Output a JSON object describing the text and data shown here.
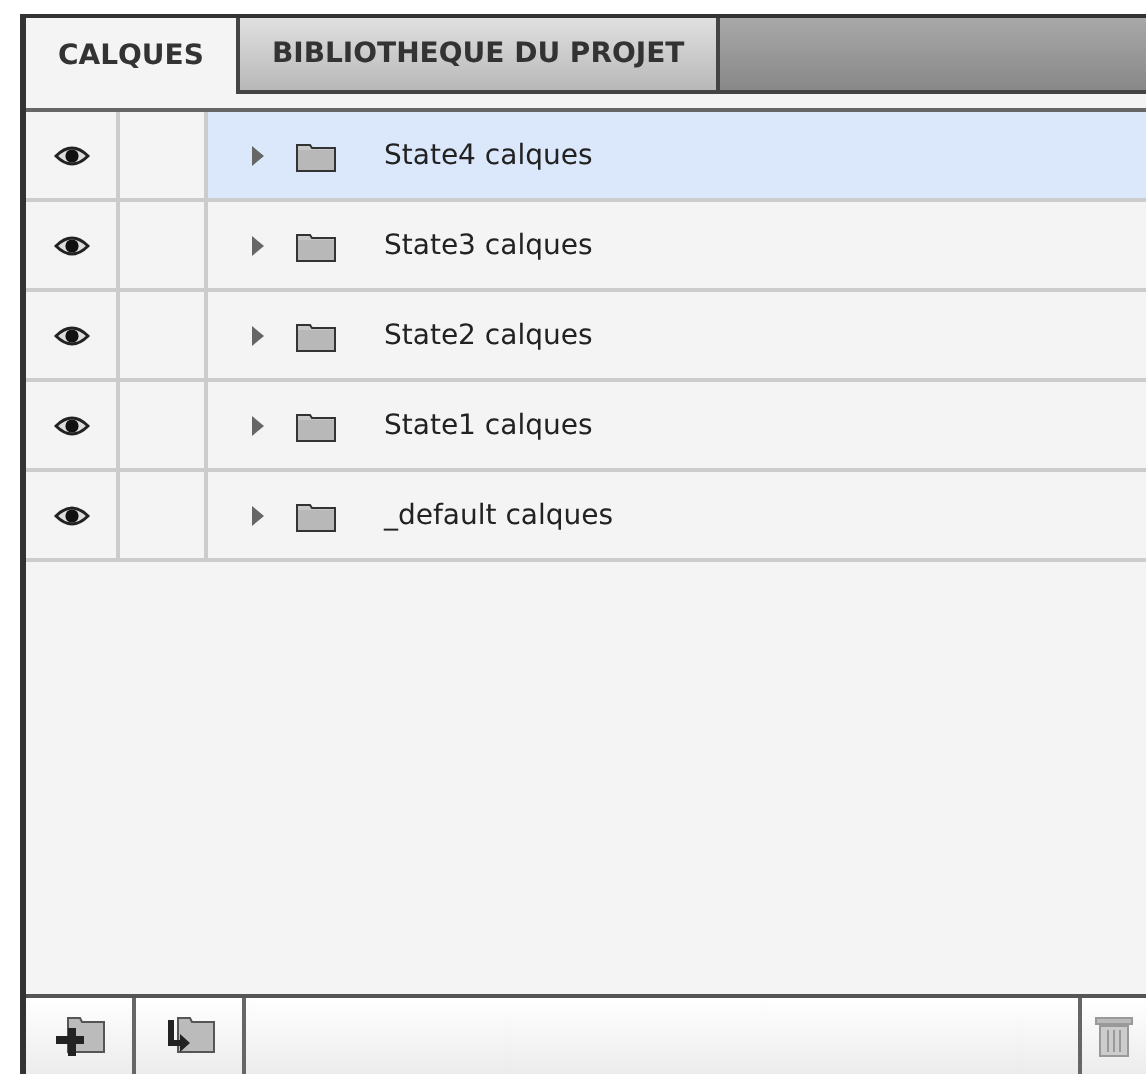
{
  "tabs": [
    {
      "label": "CALQUES",
      "selected": true
    },
    {
      "label": "BIBLIOTHEQUE DU PROJET",
      "selected": false
    }
  ],
  "layers": [
    {
      "name": "State4 calques",
      "visible": true,
      "selected": true
    },
    {
      "name": "State3 calques",
      "visible": true,
      "selected": false
    },
    {
      "name": "State2 calques",
      "visible": true,
      "selected": false
    },
    {
      "name": "State1 calques",
      "visible": true,
      "selected": false
    },
    {
      "name": "_default calques",
      "visible": true,
      "selected": false
    }
  ]
}
